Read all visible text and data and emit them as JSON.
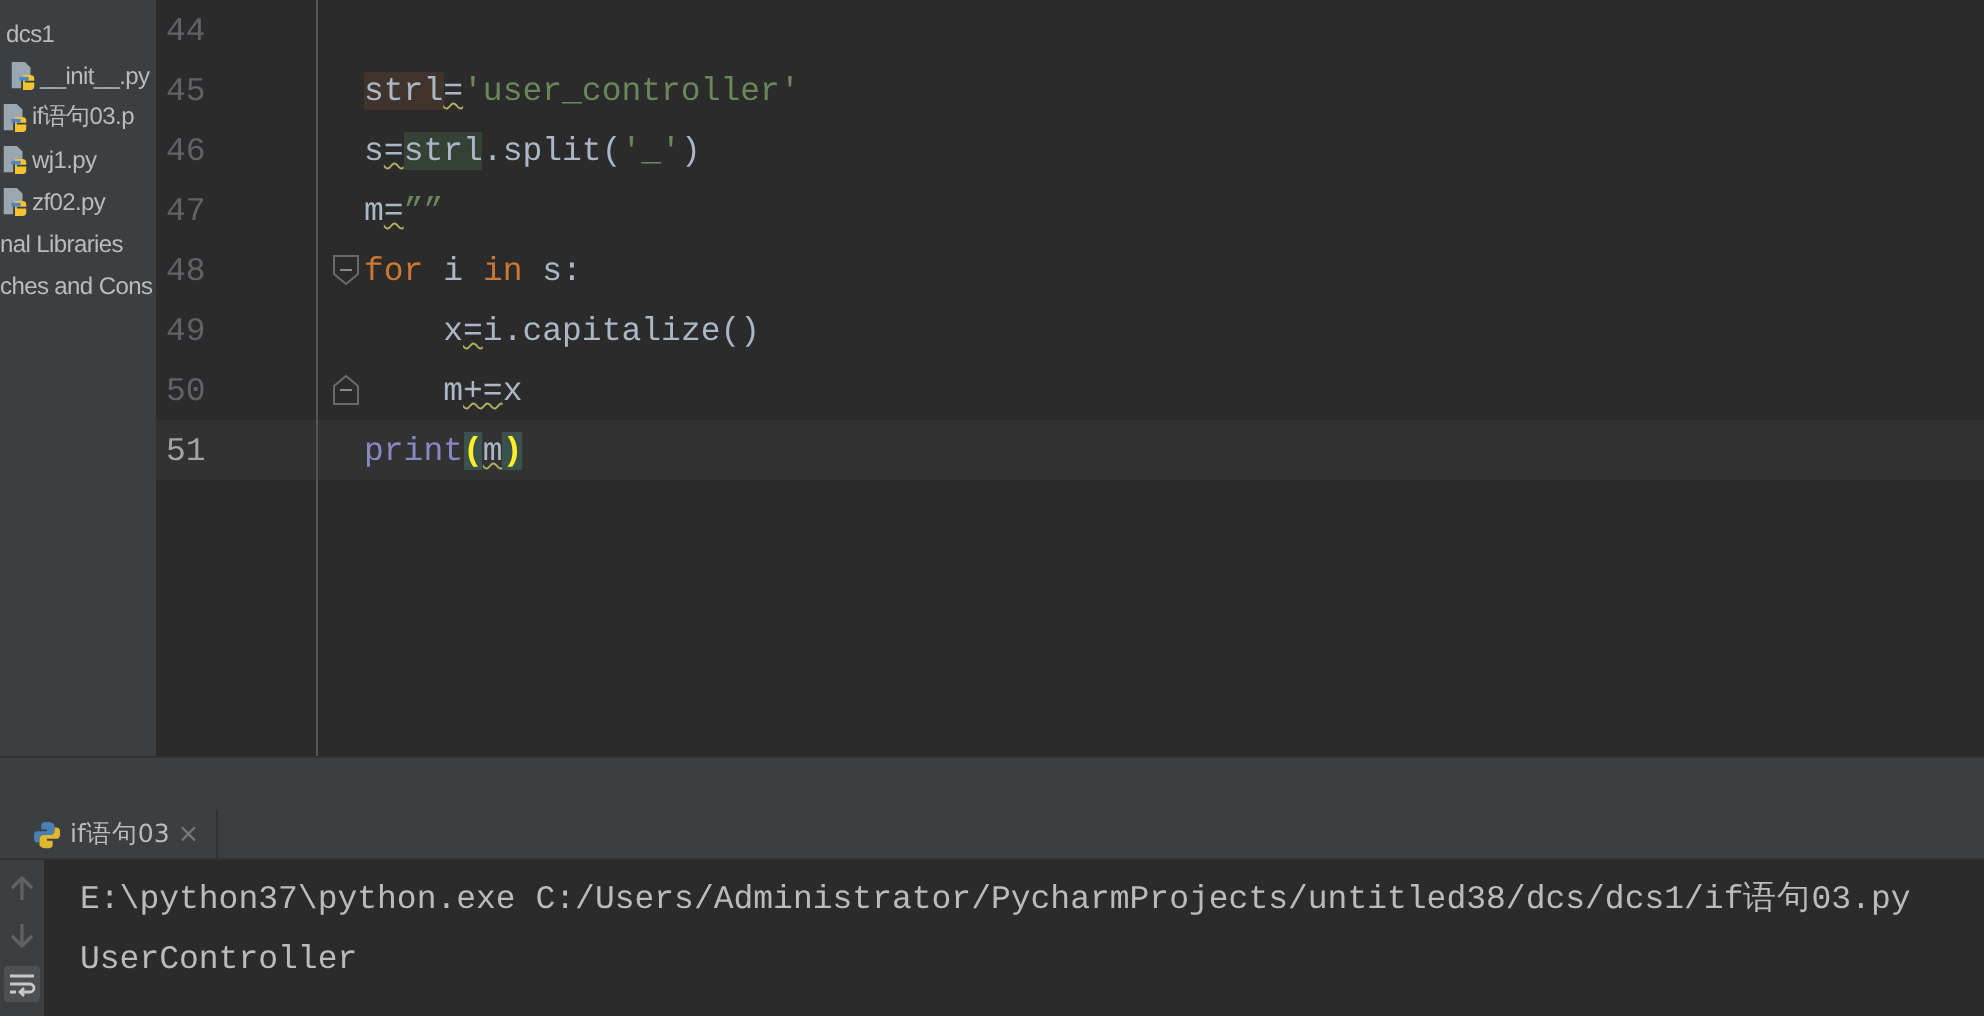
{
  "project_tree": [
    {
      "label": "dcs1",
      "children": [
        {
          "label": "__init__.py"
        },
        {
          "label": "if语句03.p"
        },
        {
          "label": "wj1.py"
        },
        {
          "label": "zf02.py"
        }
      ]
    },
    {
      "label": "nal Libraries"
    },
    {
      "label": "ches and Cons"
    }
  ],
  "editor": {
    "lines": [
      {
        "number": "44",
        "current": false
      },
      {
        "number": "45",
        "current": false,
        "tokens": [
          {
            "text": "strl",
            "kind": "write"
          },
          {
            "text": "=",
            "kind": "warned"
          },
          {
            "text": "'user_controller'",
            "kind": "string"
          }
        ]
      },
      {
        "number": "46",
        "current": false,
        "tokens": [
          {
            "text": "s",
            "kind": "plain"
          },
          {
            "text": "=",
            "kind": "warned"
          },
          {
            "text": "strl",
            "kind": "read"
          },
          {
            "text": ".split(",
            "kind": "plain"
          },
          {
            "text": "'_'",
            "kind": "string"
          },
          {
            "text": ")",
            "kind": "plain"
          }
        ]
      },
      {
        "number": "47",
        "current": false,
        "tokens": [
          {
            "text": "m",
            "kind": "plain"
          },
          {
            "text": "=",
            "kind": "warned"
          },
          {
            "text": "””",
            "kind": "string"
          }
        ]
      },
      {
        "number": "48",
        "current": false,
        "kind": "fold-start",
        "tokens": [
          {
            "text": "for",
            "kind": "keyword"
          },
          {
            "text": " i ",
            "kind": "plain"
          },
          {
            "text": "in",
            "kind": "keyword"
          },
          {
            "text": " s:",
            "kind": "plain"
          }
        ]
      },
      {
        "number": "49",
        "current": false,
        "tokens": [
          {
            "text": "    x",
            "kind": "plain"
          },
          {
            "text": "=",
            "kind": "warned"
          },
          {
            "text": "i.capitalize()",
            "kind": "plain"
          }
        ]
      },
      {
        "number": "50",
        "current": false,
        "kind": "fold-end",
        "tokens": [
          {
            "text": "    m",
            "kind": "plain"
          },
          {
            "text": "+=",
            "kind": "warned"
          },
          {
            "text": "x",
            "kind": "plain"
          }
        ]
      },
      {
        "number": "51",
        "current": true,
        "tokens": [
          {
            "text": "print",
            "kind": "builtin"
          },
          {
            "text": "(",
            "kind": "brace"
          },
          {
            "text": "m",
            "kind": "warned"
          },
          {
            "text": ")",
            "kind": "brace"
          }
        ]
      }
    ]
  },
  "run_tab": {
    "label": "if语句03",
    "close": "×"
  },
  "console": {
    "lines": [
      "E:\\python37\\python.exe C:/Users/Administrator/PycharmProjects/untitled38/dcs/dcs1/if语句03.py",
      "UserController"
    ]
  }
}
